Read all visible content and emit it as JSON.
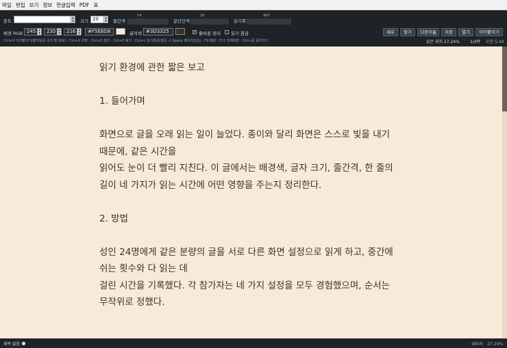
{
  "menu": [
    "파일",
    "편집",
    "보기",
    "정보",
    "한글입력",
    "PDF",
    "표"
  ],
  "toolbar": {
    "font_label": "폰트",
    "font_value": "",
    "size_label": "크기",
    "size_value": "20",
    "line_spacing_label": "줄간격",
    "line_spacing_value": "14",
    "para_spacing_label": "문단간격",
    "para_spacing_value": "18",
    "reading_width_label": "읽기폭",
    "reading_width_value": "900",
    "bg_rgb_label": "배경 RGB",
    "bg_r": "245",
    "bg_g": "235",
    "bg_b": "216",
    "bg_hex": "#F5EBD8",
    "text_color_label": "글자색",
    "text_hex": "#3D3325",
    "wrap_label": "줄바꿈 정리",
    "wrap_checked": true,
    "reading_guide_label": "읽기 참금",
    "reading_guide_checked": false,
    "buttons": [
      "새로",
      "찾기",
      "다른이름",
      "저장",
      "열기",
      "이어붙이기"
    ],
    "shortcut_hint": "Ctrl+V 이어붙이기(붙여넣은 곳이 맨 위로) · Ctrl+S 저장 · Ctrl+O 열기 · Ctrl+F 찾기 · Ctrl+L 읽기참금(참금 시 Space 페이지넘김) · F9 폐설 · F11 전체화면 · Ctrl+휠 글자크기",
    "reading_position": "읽은 위치 27.24%",
    "page_indicator": "1/4쪽",
    "clock": "오전 5:49"
  },
  "document": {
    "title": "읽기 환경에 관한 짧은 보고",
    "section1_heading": "1. 들어가며",
    "section1_line1": "화면으로 글을 오래 읽는 일이 늘었다. 종이와 달리 화면은 스스로 빛을 내기",
    "section1_line2": "때문에, 같은 시간을",
    "section1_line3": "읽어도 눈이 더 빨리 지친다. 이 글에서는 배경색, 글자 크기, 줄간격, 한 줄의",
    "section1_line4": "길이 네 가지가 읽는 시간에 어떤 영향을 주는지 정리한다.",
    "section2_heading": "2. 방법",
    "section2_line1": "성인 24명에게 같은 분량의 글을 서로 다른 화면 설정으로 읽게 하고, 중간에",
    "section2_line2": "쉬는 횟수와 다 읽는 데",
    "section2_line3": "걸린 시간을 기록했다. 각 참가자는 네 가지 설정을 모두 경험했으며, 순서는",
    "section2_line4": "무작위로 정했다."
  },
  "footer": {
    "doc_title": "제목 없음",
    "char_count": "990자",
    "percent": "27.24%"
  },
  "colors": {
    "background": "#F5EBD8",
    "text": "#3D3325",
    "toolbar": "#1E2328"
  },
  "scroll_fraction": 0.2724
}
